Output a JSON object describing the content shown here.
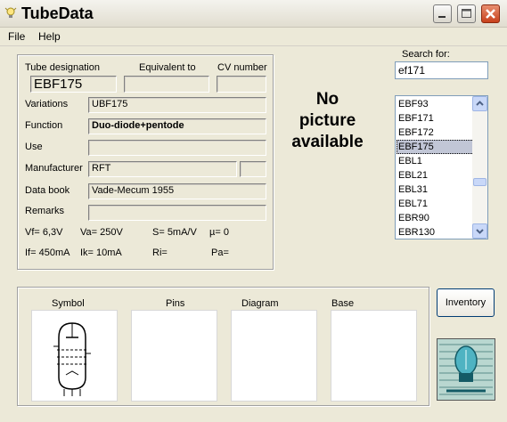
{
  "window": {
    "title": "TubeData"
  },
  "menu": [
    {
      "label": "File"
    },
    {
      "label": "Help"
    }
  ],
  "search": {
    "label": "Search for:",
    "value": "ef171"
  },
  "tube_list": {
    "items": [
      "EBF93",
      "EBF171",
      "EBF172",
      "EBF175",
      "EBL1",
      "EBL21",
      "EBL31",
      "EBL71",
      "EBR90",
      "EBR130"
    ],
    "selected": "EBF175"
  },
  "details": {
    "designation_label": "Tube designation",
    "designation_value": "EBF175",
    "equivalent_label": "Equivalent to",
    "equivalent_value": "",
    "cv_label": "CV number",
    "cv_value": "",
    "variations_label": "Variations",
    "variations_value": "UBF175",
    "function_label": "Function",
    "function_value": "Duo-diode+pentode",
    "use_label": "Use",
    "use_value": "",
    "manufacturer_label": "Manufacturer",
    "manufacturer_value": "RFT",
    "manufacturer_extra": "",
    "databook_label": "Data book",
    "databook_value": "Vade-Mecum 1955",
    "remarks_label": "Remarks",
    "remarks_value": ""
  },
  "specs": {
    "vf": "Vf= 6,3V",
    "va": "Va= 250V",
    "s": "S= 5mA/V",
    "mu": "µ=   0",
    "if": "If= 450mA",
    "ik": "Ik=  10mA",
    "ri": "Ri=",
    "pa": "Pa="
  },
  "picture": {
    "line1": "No",
    "line2": "picture",
    "line3": "available"
  },
  "bottom": {
    "symbol_label": "Symbol",
    "pins_label": "Pins",
    "diagram_label": "Diagram",
    "base_label": "Base"
  },
  "inventory_button": "Inventory",
  "colors": {
    "title_close": "#c8411c",
    "list_selection": "#c1c6d6",
    "window_bg": "#ece9d8"
  }
}
